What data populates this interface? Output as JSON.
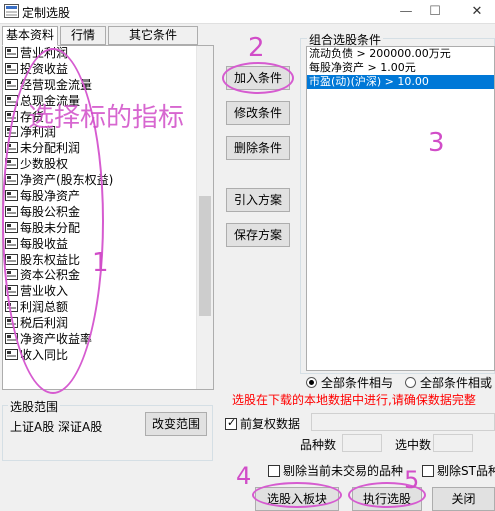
{
  "window": {
    "title": "定制选股",
    "min": "—",
    "max": "☐",
    "close": "✕"
  },
  "tabs": [
    "基本资料",
    "行情",
    "其它条件"
  ],
  "indicators": [
    "营业利润",
    "投资收益",
    "经营现金流量",
    "总现金流量",
    "存货",
    "净利润",
    "未分配利润",
    "少数股权",
    "净资产(股东权益)",
    "每股净资产",
    "每股公积金",
    "每股未分配",
    "每股收益",
    "股东权益比",
    "资本公积金",
    "营业收入",
    "利润总额",
    "税后利润",
    "净资产收益率",
    "收入同比"
  ],
  "buttons": {
    "add": "加入条件",
    "modify": "修改条件",
    "delete": "删除条件",
    "import": "引入方案",
    "save": "保存方案",
    "change_range": "改变范围",
    "select_block": "选股入板块",
    "execute": "执行选股",
    "close": "关闭"
  },
  "conditions": {
    "caption": "组合选股条件",
    "items": [
      "流动负债 > 200000.00万元",
      "每股净资产 > 1.00元",
      "市盈(动)(沪深) > 10.00"
    ]
  },
  "logic": {
    "and": "全部条件相与",
    "or": "全部条件相或"
  },
  "notice": "选股在下载的本地数据中进行,请确保数据完整",
  "range": {
    "caption": "选股范围",
    "value": "上证A股 深证A股"
  },
  "options": {
    "restore_rights": "前复权数据",
    "variety_count": "品种数",
    "selected_count": "选中数",
    "exclude_untraded": "剔除当前未交易的品种",
    "exclude_st": "剔除ST品种"
  },
  "annotations": {
    "overlay_text": "选择标的指标",
    "n1": "1",
    "n2": "2",
    "n3": "3",
    "n4": "4",
    "n5": "5"
  },
  "colors": {
    "annotation": "#d14dc8",
    "selection": "#0078d7",
    "notice": "#ff0000"
  }
}
